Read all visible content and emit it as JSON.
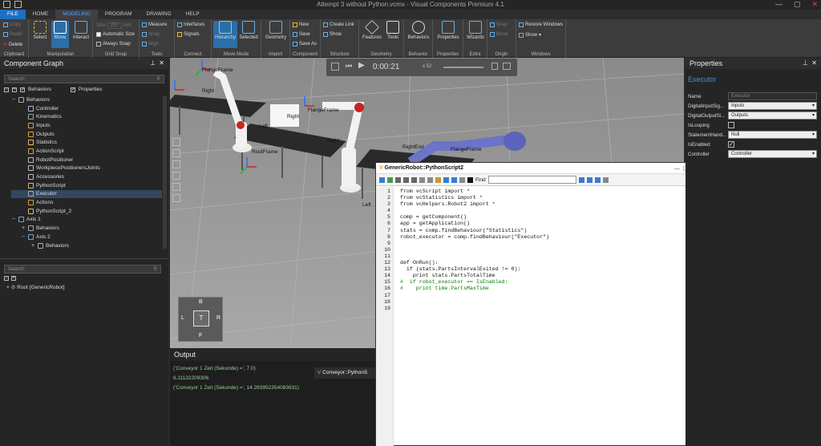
{
  "window": {
    "title": "Attempt 3 without Python.vcmx - Visual Components Premium 4.1"
  },
  "menu": {
    "items": [
      "FILE",
      "HOME",
      "MODELING",
      "PROGRAM",
      "DRAWING",
      "HELP"
    ],
    "active": "MODELING"
  },
  "ribbon": {
    "clipboard": {
      "label": "Clipboard",
      "copy": "Copy",
      "paste": "Paste",
      "delete": "Delete"
    },
    "manipulation": {
      "label": "Manipulation",
      "select": "Select",
      "move": "Move",
      "interact": "Interact"
    },
    "gridsnap": {
      "label": "Grid Snap",
      "size": "Size",
      "size_value": "250",
      "unit": "mm",
      "auto": "Automatic Size",
      "always": "Always Snap"
    },
    "tools": {
      "label": "Tools",
      "measure": "Measure",
      "snap": "Snap",
      "align": "Align"
    },
    "connect": {
      "label": "Connect",
      "interfaces": "Interfaces",
      "signals": "Signals"
    },
    "movemode": {
      "label": "Move Mode",
      "hierarchy": "Hierarchy",
      "selected": "Selected"
    },
    "import": {
      "label": "Import",
      "geometry": "Geometry"
    },
    "component": {
      "label": "Component",
      "new": "New",
      "save": "Save",
      "saveas": "Save As"
    },
    "structure": {
      "label": "Structure",
      "createlink": "Create Link",
      "show": "Show"
    },
    "geometry": {
      "label": "Geometry",
      "features": "Features",
      "tools": "Tools"
    },
    "behavior": {
      "label": "Behavior",
      "behaviors": "Behaviors"
    },
    "properties": {
      "label": "Properties",
      "properties": "Properties"
    },
    "extra": {
      "label": "Extra",
      "wizards": "Wizards"
    },
    "origin": {
      "label": "Origin",
      "snap": "Snap",
      "move": "Move"
    },
    "windows": {
      "label": "Windows",
      "restore": "Restore Windows",
      "show": "Show"
    }
  },
  "component_graph": {
    "title": "Component Graph",
    "search_placeholder": "Search",
    "filter_behaviors": "Behaviors",
    "filter_properties": "Properties",
    "tree": [
      {
        "label": "Behaviors",
        "indent": 1,
        "exp": "−",
        "icon": "#aaa"
      },
      {
        "label": "Controller",
        "indent": 2,
        "exp": "",
        "icon": "#9fb8d0"
      },
      {
        "label": "Kinematics",
        "indent": 2,
        "exp": "",
        "icon": "#8aa"
      },
      {
        "label": "Inputs",
        "indent": 2,
        "exp": "",
        "icon": "#e0a030"
      },
      {
        "label": "Outputs",
        "indent": 2,
        "exp": "",
        "icon": "#e0a030"
      },
      {
        "label": "Statistics",
        "indent": 2,
        "exp": "",
        "icon": "#e0c060"
      },
      {
        "label": "ActionScript",
        "indent": 2,
        "exp": "",
        "icon": "#e0a030"
      },
      {
        "label": "RobotPositioner",
        "indent": 2,
        "exp": "",
        "icon": "#bbb"
      },
      {
        "label": "WorkpiecePositionersJoints",
        "indent": 2,
        "exp": "",
        "icon": "#bbb"
      },
      {
        "label": "Accessories",
        "indent": 2,
        "exp": "",
        "icon": "#bbb"
      },
      {
        "label": "PythonScript",
        "indent": 2,
        "exp": "",
        "icon": "#e0c060"
      },
      {
        "label": "Executor",
        "indent": 2,
        "exp": "",
        "icon": "#aaa",
        "selected": true
      },
      {
        "label": "Actions",
        "indent": 2,
        "exp": "",
        "icon": "#e0a030"
      },
      {
        "label": "PythonScript_2",
        "indent": 2,
        "exp": "",
        "icon": "#e0c060"
      },
      {
        "label": "Axis 1",
        "indent": 1,
        "exp": "−",
        "icon": "#7aa0d0"
      },
      {
        "label": "Behaviors",
        "indent": 2,
        "exp": "+",
        "icon": "#aaa"
      },
      {
        "label": "Axis 2",
        "indent": 2,
        "exp": "−",
        "icon": "#7aa0d0"
      },
      {
        "label": "Behaviors",
        "indent": 3,
        "exp": "+",
        "icon": "#aaa"
      }
    ],
    "search2_placeholder": "Search",
    "root_label": "Root [GenericRobot]"
  },
  "playbar": {
    "time": "0:00:21",
    "speed": "x 52"
  },
  "viewport": {
    "labels": [
      {
        "text": "FlangeFrame",
        "key": "a"
      },
      {
        "text": "Right",
        "key": "b"
      },
      {
        "text": "Right",
        "key": "c"
      },
      {
        "text": "FlangeFrame",
        "key": "d"
      },
      {
        "text": "Left",
        "key": "e"
      },
      {
        "text": "RootFrame",
        "key": "f"
      },
      {
        "text": "Right",
        "key": "g"
      },
      {
        "text": "RightEnd",
        "key": "h"
      },
      {
        "text": "FlangeFrame",
        "key": "i"
      },
      {
        "text": "Left",
        "key": "j"
      }
    ],
    "navcube": {
      "top": "B",
      "left": "L",
      "center": "T",
      "right": "R",
      "bottom": "F"
    }
  },
  "output": {
    "title": "Output",
    "lines": [
      "('Conveyor 1 Zeit (Sekunde) =', 7.0)",
      "6.11132209306",
      "('Conveyor 1 Zeit (Sekunde) =', 14.283952354083631)"
    ],
    "tab": "Conveyor::PythonS"
  },
  "script": {
    "title": "GenericRobot::PythonScript2",
    "find_label": "Find",
    "lines": [
      {
        "n": "1",
        "t": "from vcScript import *"
      },
      {
        "n": "2",
        "t": "from vcStatistics import *"
      },
      {
        "n": "3",
        "t": "from vcHelpers.Robot2 import *"
      },
      {
        "n": "4",
        "t": ""
      },
      {
        "n": "5",
        "t": "comp = getComponent()"
      },
      {
        "n": "6",
        "t": "app = getApplication()"
      },
      {
        "n": "7",
        "t": "stats = comp.findBehaviour(\"Statistics\")"
      },
      {
        "n": "8",
        "t": "robot_executor = comp.findBehaviour(\"Executor\")"
      },
      {
        "n": "9",
        "t": ""
      },
      {
        "n": "10",
        "t": ""
      },
      {
        "n": "11",
        "t": ""
      },
      {
        "n": "12",
        "t": "def OnRun():"
      },
      {
        "n": "13",
        "t": "  if (stats.PartsIntervalExited != 0):"
      },
      {
        "n": "14",
        "t": "    print stats.PartsTotalTime"
      },
      {
        "n": "15",
        "t": "#  if robot_executor == IsEnabled:"
      },
      {
        "n": "16",
        "t": "#    print time.PartsMaxTime"
      },
      {
        "n": "17",
        "t": ""
      },
      {
        "n": "18",
        "t": ""
      },
      {
        "n": "19",
        "t": ""
      }
    ]
  },
  "properties": {
    "title": "Properties",
    "heading": "Executor",
    "rows": [
      {
        "label": "Name",
        "value": "Executor",
        "kind": "text"
      },
      {
        "label": "DigitalInputSig...",
        "value": "Inputs",
        "kind": "select"
      },
      {
        "label": "DigitalOutputSi...",
        "value": "Outputs",
        "kind": "select"
      },
      {
        "label": "IsLooping",
        "value": "",
        "kind": "check"
      },
      {
        "label": "StatementHand...",
        "value": "Null",
        "kind": "select"
      },
      {
        "label": "IsEnabled",
        "value": "✓",
        "kind": "check"
      },
      {
        "label": "Controller",
        "value": "Controller",
        "kind": "select"
      }
    ]
  },
  "colors": {
    "accent": "#1e6fc0",
    "selection": "#33485f"
  }
}
